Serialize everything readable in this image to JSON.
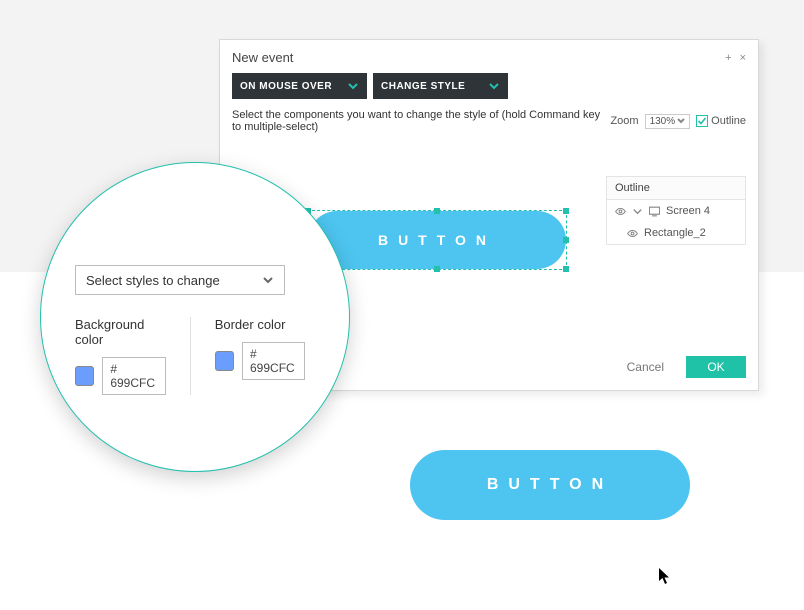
{
  "dialog": {
    "title": "New event",
    "trigger_label": "ON MOUSE OVER",
    "action_label": "CHANGE STYLE",
    "instruction": "Select the components you want to change the style of (hold Command key to multiple-select)",
    "zoom_label": "Zoom",
    "zoom_value": "130%",
    "outline_checkbox_label": "Outline",
    "outline_panel_title": "Outline",
    "outline_items": [
      {
        "label": "Screen 4",
        "is_screen": true
      },
      {
        "label": "Rectangle_2",
        "is_screen": false
      }
    ],
    "selected_button_text": "BUTTON",
    "mini_label_border": "er color",
    "mini_hex": "# 699CFC",
    "cancel_label": "Cancel",
    "ok_label": "OK"
  },
  "lens": {
    "select_placeholder": "Select styles to change",
    "background_color_label": "Background color",
    "border_color_label": "Border color",
    "background_hex": "# 699CFC",
    "border_hex": "# 699CFC",
    "swatch_color": "#699CFC"
  },
  "preview_button_text": "BUTTON"
}
